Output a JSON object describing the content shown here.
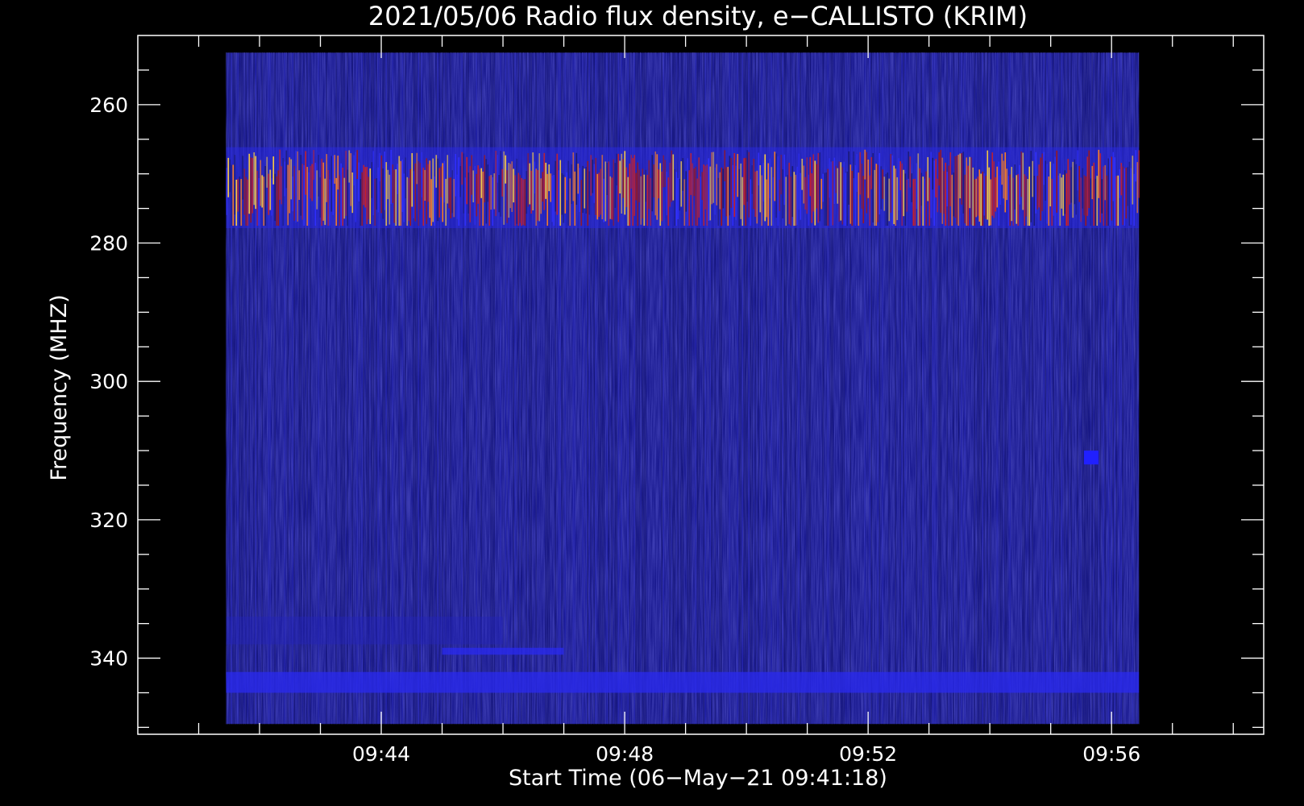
{
  "chart_data": {
    "type": "heatmap",
    "title": "2021/05/06  Radio flux density, e−CALLISTO (KRIM)",
    "xlabel": "Start Time (06−May−21 09:41:18)",
    "ylabel": "Frequency (MHZ)",
    "x_axis": {
      "start": "09:41:18",
      "range_minutes_after_0941": [
        -1.0,
        17.5
      ],
      "data_extent_minutes_after_0941": [
        0.45,
        15.45
      ],
      "major_tick_labels": [
        "09:44",
        "09:48",
        "09:52",
        "09:56"
      ],
      "major_tick_minutes_after_0941": [
        3,
        7,
        11,
        15
      ]
    },
    "y_axis": {
      "inverted": true,
      "range_mhz": [
        250,
        351
      ],
      "data_extent_mhz": [
        252.5,
        349.5
      ],
      "major_tick_labels": [
        "260",
        "280",
        "300",
        "320",
        "340"
      ],
      "major_tick_values": [
        260,
        280,
        300,
        320,
        340
      ]
    },
    "colormap": "dark-blue background with red/orange/yellow high intensity",
    "features": [
      {
        "name": "strong band",
        "freq_mhz": [
          266.5,
          277.5
        ],
        "time_extent": "full",
        "intensity": "high"
      },
      {
        "name": "faint band",
        "freq_mhz": [
          334,
          338
        ],
        "time_extent": "09:41–09:46",
        "intensity": "low"
      },
      {
        "name": "bright streak",
        "freq_mhz": [
          338.5,
          339.5
        ],
        "time_extent": "09:45–09:47",
        "intensity": "medium"
      },
      {
        "name": "lower band",
        "freq_mhz": [
          342,
          345
        ],
        "time_extent": "full",
        "intensity": "medium"
      },
      {
        "name": "spot",
        "freq_mhz": [
          310,
          312
        ],
        "time": "09:55:40",
        "intensity": "medium"
      }
    ],
    "grid": false
  },
  "colors": {
    "background": "#000000",
    "axis": "#ffffff",
    "base": "#1a1a90",
    "band": "#c02020"
  }
}
